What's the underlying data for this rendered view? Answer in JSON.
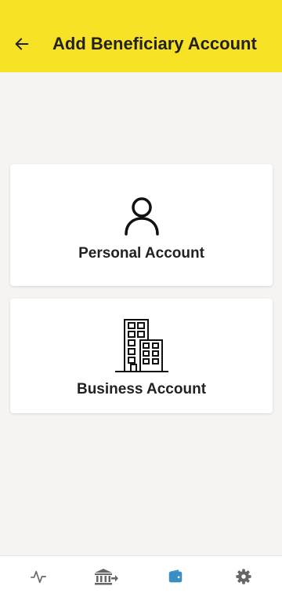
{
  "header": {
    "title": "Add Beneficiary Account",
    "back_icon": "arrow-left-icon",
    "background_color": "#f7e225"
  },
  "options": [
    {
      "label": "Personal Account",
      "icon": "person-icon"
    },
    {
      "label": "Business Account",
      "icon": "buildings-icon"
    }
  ],
  "bottom_nav": {
    "items": [
      {
        "icon": "activity-icon",
        "active": false
      },
      {
        "icon": "bank-transfer-icon",
        "active": false
      },
      {
        "icon": "wallet-icon",
        "active": true
      },
      {
        "icon": "settings-icon",
        "active": false
      }
    ],
    "active_color": "#3a8ec4",
    "inactive_color": "#666666"
  }
}
